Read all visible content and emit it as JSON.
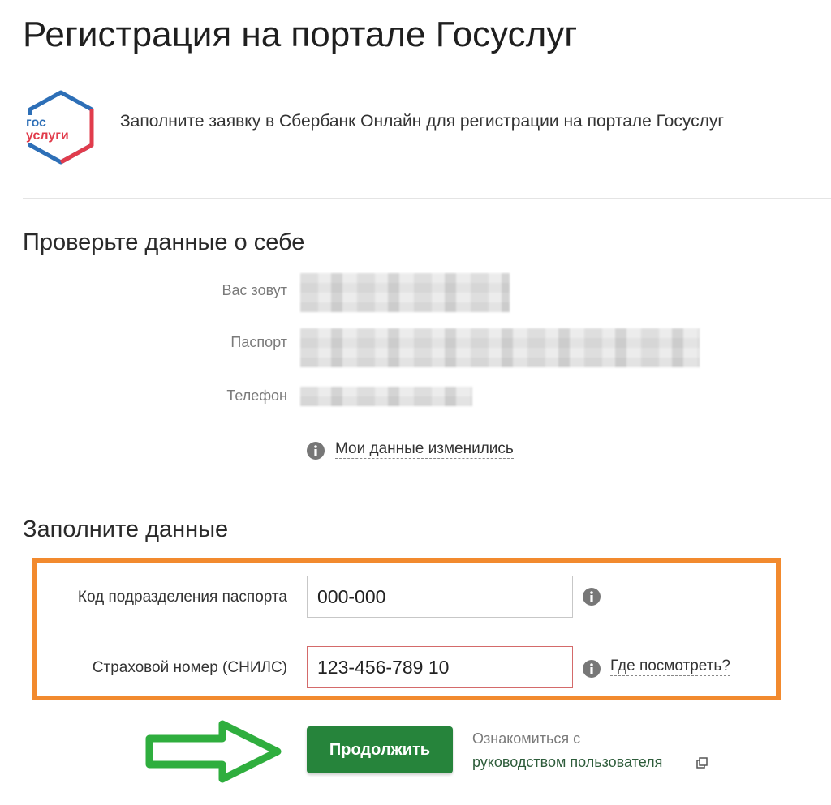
{
  "page": {
    "title": "Регистрация на портале Госуслуг"
  },
  "logo": {
    "line1": "гос",
    "line2": "услуги",
    "icon": "gosuslugi-logo",
    "colors": {
      "blue": "#2d6fb7",
      "red": "#e13c4c"
    }
  },
  "intro": {
    "text": "Заполните заявку в Сбербанк Онлайн для регистрации на портале Госуслуг"
  },
  "check_section": {
    "title": "Проверьте данные о себе",
    "fields": [
      {
        "label": "Вас зовут"
      },
      {
        "label": "Паспорт"
      },
      {
        "label": "Телефон"
      }
    ],
    "changed_link": "Мои данные изменились",
    "changed_icon": "info-icon"
  },
  "fill_section": {
    "title": "Заполните данные",
    "passport_code": {
      "label": "Код подразделения паспорта",
      "value": "000-000",
      "icon": "info-icon"
    },
    "snils": {
      "label": "Страховой номер (СНИЛС)",
      "value": "123-456-789 10",
      "icon": "info-icon",
      "help_link": "Где посмотреть?"
    },
    "highlight_color": "#f28a2e"
  },
  "actions": {
    "continue_label": "Продолжить",
    "button_color": "#26843b",
    "arrow_color": "#2fae3e",
    "guide_prefix": "Ознакомиться с",
    "guide_link": "руководством пользователя",
    "guide_icon": "external-link-icon"
  }
}
